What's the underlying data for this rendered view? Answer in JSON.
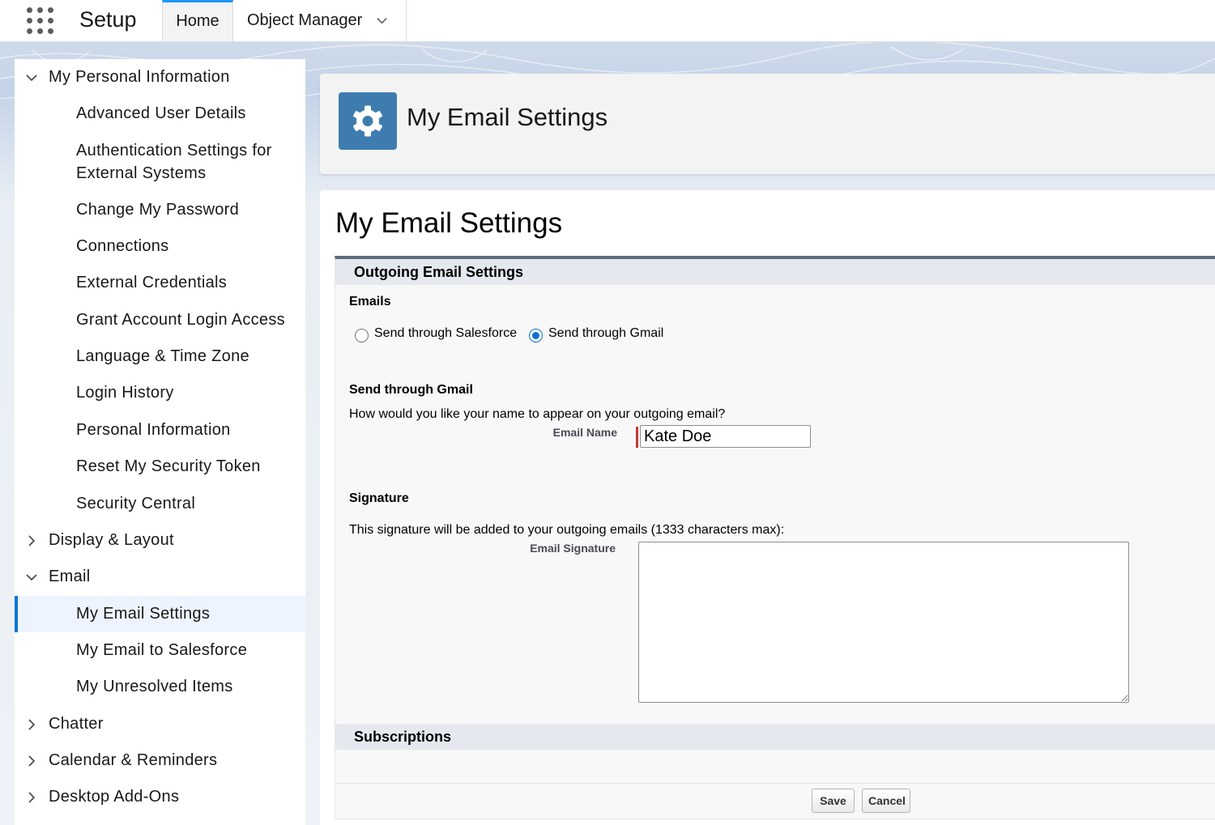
{
  "topbar": {
    "app_icon": "app-launcher-grid-icon",
    "app_title": "Setup",
    "tabs": [
      {
        "label": "Home",
        "active": true
      },
      {
        "label": "Object Manager",
        "has_dropdown": true
      }
    ]
  },
  "sidebar": {
    "items": [
      {
        "label": "My Personal Information",
        "level": 0,
        "expanded": true
      },
      {
        "label": "Advanced User Details",
        "level": 1
      },
      {
        "label": "Authentication Settings for",
        "label_line2": "External Systems",
        "level": 1
      },
      {
        "label": "Change My Password",
        "level": 1
      },
      {
        "label": "Connections",
        "level": 1
      },
      {
        "label": "External Credentials",
        "level": 1
      },
      {
        "label": "Grant Account Login Access",
        "level": 1
      },
      {
        "label": "Language & Time Zone",
        "level": 1
      },
      {
        "label": "Login History",
        "level": 1
      },
      {
        "label": "Personal Information",
        "level": 1
      },
      {
        "label": "Reset My Security Token",
        "level": 1
      },
      {
        "label": "Security Central",
        "level": 1
      },
      {
        "label": "Display & Layout",
        "level": 0,
        "expanded": false
      },
      {
        "label": "Email",
        "level": 0,
        "expanded": true
      },
      {
        "label": "My Email Settings",
        "level": 1,
        "selected": true
      },
      {
        "label": "My Email to Salesforce",
        "level": 1
      },
      {
        "label": "My Unresolved Items",
        "level": 1
      },
      {
        "label": "Chatter",
        "level": 0,
        "expanded": false
      },
      {
        "label": "Calendar & Reminders",
        "level": 0,
        "expanded": false
      },
      {
        "label": "Desktop Add-Ons",
        "level": 0,
        "expanded": false
      }
    ]
  },
  "header": {
    "icon": "gear-icon",
    "title": "My Email Settings"
  },
  "main": {
    "title": "My Email Settings",
    "outgoing_section": {
      "heading": "Outgoing Email Settings",
      "emails_label": "Emails",
      "radio_options": [
        {
          "label": "Send through Salesforce",
          "checked": false
        },
        {
          "label": "Send through Gmail",
          "checked": true
        }
      ],
      "gmail_heading": "Send through Gmail",
      "gmail_question": "How would you like your name to appear on your outgoing email?",
      "email_name_label": "Email Name",
      "email_name_value": "Kate Doe",
      "signature_heading": "Signature",
      "signature_help": "This signature will be added to your outgoing emails (1333 characters max):",
      "signature_label": "Email Signature",
      "signature_value": ""
    },
    "subscriptions_heading": "Subscriptions",
    "buttons": {
      "save": "Save",
      "cancel": "Cancel"
    }
  },
  "colors": {
    "accent_blue": "#0176d3",
    "header_icon_bg": "#3e7cb0",
    "required_red": "#c23934"
  }
}
